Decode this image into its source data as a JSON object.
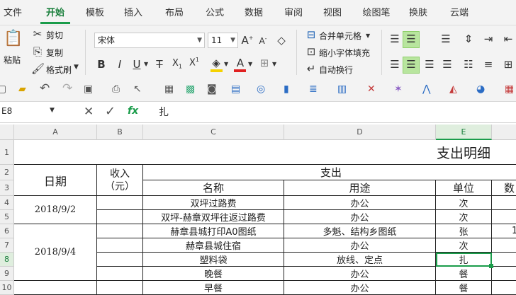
{
  "menu": [
    "文件",
    "开始",
    "模板",
    "插入",
    "布局",
    "公式",
    "数据",
    "审阅",
    "视图",
    "绘图笔",
    "换肤",
    "云端"
  ],
  "clipboard": {
    "paste": "粘贴",
    "cut": "剪切",
    "copy": "复制",
    "format_painter": "格式刷"
  },
  "font": {
    "name": "宋体",
    "size": "11"
  },
  "align": {
    "merge": "合并单元格",
    "shrink": "缩小字体填充",
    "wrap": "自动换行"
  },
  "formula_bar": {
    "cell_ref": "E8",
    "fx": "fx",
    "content": "扎"
  },
  "columns": [
    "A",
    "B",
    "C",
    "D",
    "E"
  ],
  "rows": [
    "1",
    "2",
    "3",
    "4",
    "5",
    "6",
    "7",
    "8",
    "9",
    "10"
  ],
  "sheet": {
    "title": "支出明细",
    "header_date": "日期",
    "header_income": "收入　（元）",
    "header_expense": "支出",
    "sub_name": "名称",
    "sub_use": "用途",
    "sub_unit": "单位",
    "sub_qty": "数",
    "date1": "2018/9/2",
    "date2": "2018/9/4",
    "r4": {
      "name": "双坪过路费",
      "use": "办公",
      "unit": "次"
    },
    "r5": {
      "name": "双坪-赫章双坪往返过路费",
      "use": "办公",
      "unit": "次"
    },
    "r6": {
      "name": "赫章县城打印A0图纸",
      "use": "多魁、结构乡图纸",
      "unit": "张",
      "qty": "1"
    },
    "r7": {
      "name": "赫章县城住宿",
      "use": "办公",
      "unit": "次"
    },
    "r8": {
      "name": "塑料袋",
      "use": "放线、定点",
      "unit": "扎"
    },
    "r9": {
      "name": "晚餐",
      "use": "办公",
      "unit": "餐"
    },
    "r10": {
      "name": "早餐",
      "use": "办公",
      "unit": "餐"
    }
  },
  "accent": "#1a9c4a"
}
